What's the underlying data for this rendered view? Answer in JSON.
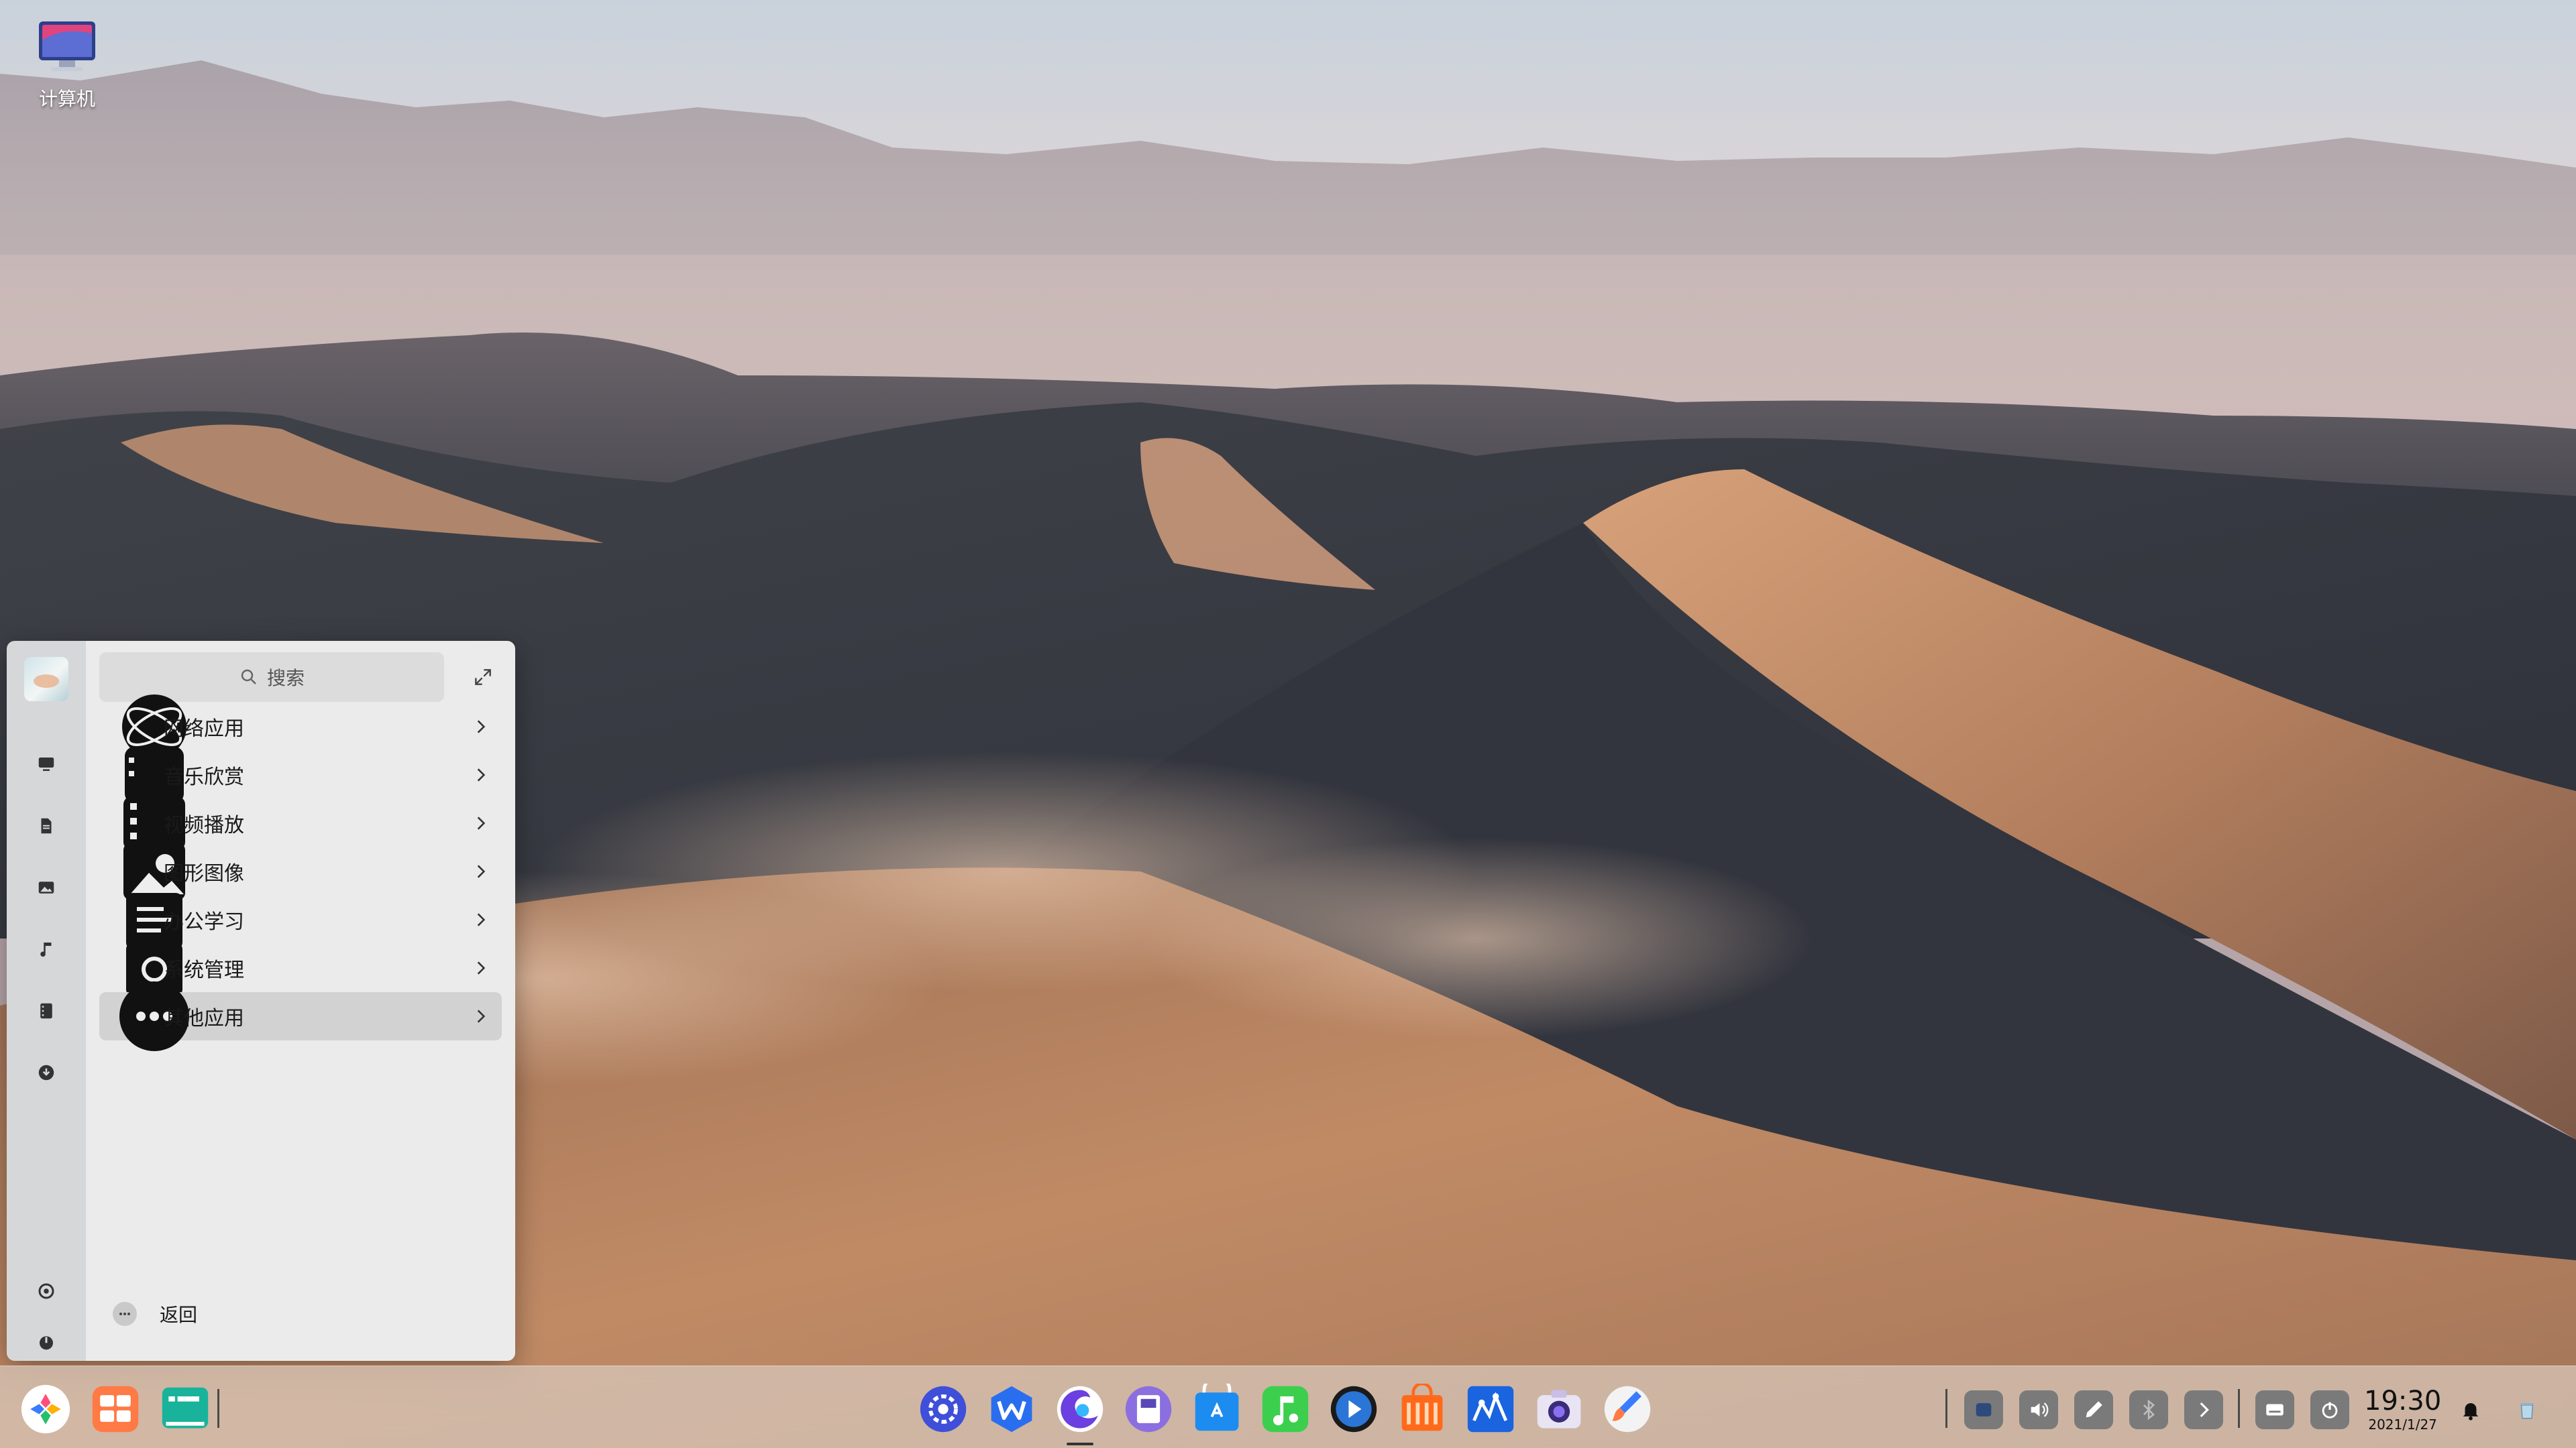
{
  "desktop": {
    "icons": [
      {
        "label": "计算机",
        "icon": "computer-icon"
      }
    ]
  },
  "start_menu": {
    "search": {
      "placeholder": "搜索"
    },
    "side_rail": [
      {
        "icon": "monitor-icon"
      },
      {
        "icon": "document-icon"
      },
      {
        "icon": "image-icon"
      },
      {
        "icon": "music-icon"
      },
      {
        "icon": "video-icon"
      },
      {
        "icon": "download-icon"
      },
      {
        "icon": "settings-icon"
      },
      {
        "icon": "power-icon"
      }
    ],
    "categories": [
      {
        "label": "网络应用",
        "icon": "network-icon"
      },
      {
        "label": "音乐欣赏",
        "icon": "music-app-icon"
      },
      {
        "label": "视频播放",
        "icon": "video-app-icon"
      },
      {
        "label": "图形图像",
        "icon": "graphics-icon"
      },
      {
        "label": "办公学习",
        "icon": "office-icon"
      },
      {
        "label": "系统管理",
        "icon": "system-icon"
      },
      {
        "label": "其他应用",
        "icon": "other-apps-icon",
        "active": true
      }
    ],
    "back_label": "返回"
  },
  "taskbar": {
    "left": [
      {
        "icon": "launcher-icon"
      },
      {
        "icon": "multitask-icon"
      },
      {
        "icon": "desktop-switch-icon"
      }
    ],
    "apps": [
      {
        "icon": "system-settings-icon"
      },
      {
        "icon": "wps-icon"
      },
      {
        "icon": "browser-icon"
      },
      {
        "icon": "file-manager-icon"
      },
      {
        "icon": "app-store-icon"
      },
      {
        "icon": "music-player-icon"
      },
      {
        "icon": "video-player-icon"
      },
      {
        "icon": "shopping-bag-icon"
      },
      {
        "icon": "drawing-icon"
      },
      {
        "icon": "camera-icon"
      },
      {
        "icon": "paint-icon"
      }
    ],
    "tray": [
      {
        "icon": "input-method-icon"
      },
      {
        "icon": "volume-icon"
      },
      {
        "icon": "pen-icon"
      },
      {
        "icon": "bluetooth-icon"
      },
      {
        "icon": "expand-tray-icon"
      },
      {
        "icon": "keyboard-icon"
      },
      {
        "icon": "shutdown-icon"
      }
    ],
    "clock": {
      "time": "19:30",
      "date": "2021/1/27"
    },
    "notification_icon": "bell-icon",
    "trash_icon": "trash-icon"
  }
}
